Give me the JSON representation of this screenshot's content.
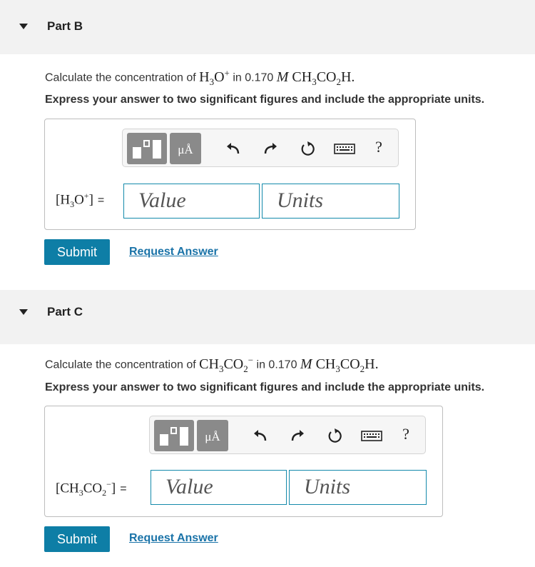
{
  "parts": [
    {
      "title": "Part B",
      "question_prefix": "Calculate the concentration of ",
      "question_species": "H3O+",
      "question_middle": " in 0.170 ",
      "question_molar": "M",
      "question_solution": "CH3CO2H.",
      "instruction": "Express your answer to two significant figures and include the appropriate units.",
      "answer_label": "[H3O+] =",
      "value_placeholder": "Value",
      "units_placeholder": "Units",
      "submit_label": "Submit",
      "request_label": "Request Answer"
    },
    {
      "title": "Part C",
      "question_prefix": "Calculate the concentration of ",
      "question_species": "CH3CO2−",
      "question_middle": " in 0.170 ",
      "question_molar": "M",
      "question_solution": "CH3CO2H.",
      "instruction": "Express your answer to two significant figures and include the appropriate units.",
      "answer_label": "[CH3CO2−] =",
      "value_placeholder": "Value",
      "units_placeholder": "Units",
      "submit_label": "Submit",
      "request_label": "Request Answer"
    }
  ],
  "toolbar": {
    "units_glyph": "μÅ",
    "help_glyph": "?"
  },
  "colors": {
    "accent": "#0e7ea6",
    "field_border": "#148aab",
    "header_bg": "#f2f2f2",
    "tool_button": "#8a8a8a"
  },
  "icons": [
    "collapse-caret-icon",
    "templates-icon",
    "units-icon",
    "undo-icon",
    "redo-icon",
    "reset-icon",
    "keyboard-icon",
    "help-icon"
  ]
}
